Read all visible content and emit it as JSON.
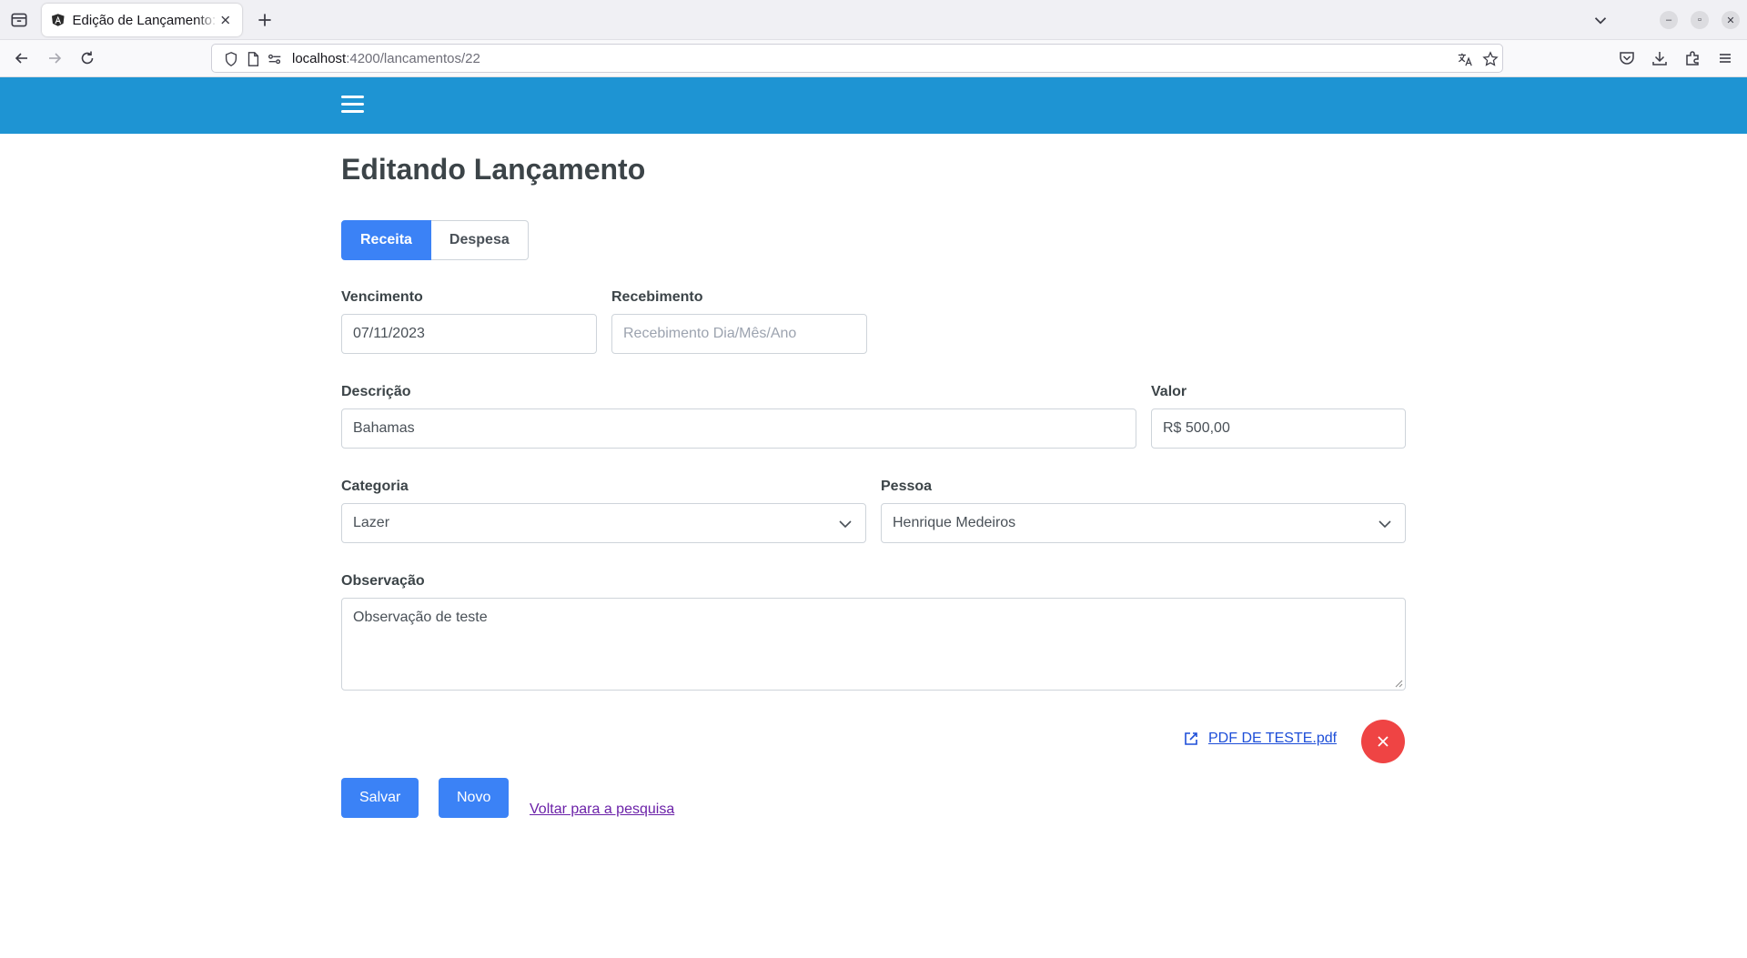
{
  "browser": {
    "tab_title": "Edição de Lançamento: B",
    "url_host": "localhost",
    "url_path": ":4200/lancamentos/22"
  },
  "page": {
    "title": "Editando Lançamento"
  },
  "type_toggle": {
    "options": [
      "Receita",
      "Despesa"
    ],
    "selected": "Receita"
  },
  "form": {
    "vencimento": {
      "label": "Vencimento",
      "value": "07/11/2023"
    },
    "recebimento": {
      "label": "Recebimento",
      "value": "",
      "placeholder": "Recebimento Dia/Mês/Ano"
    },
    "descricao": {
      "label": "Descrição",
      "value": "Bahamas"
    },
    "valor": {
      "label": "Valor",
      "value": "R$ 500,00"
    },
    "categoria": {
      "label": "Categoria",
      "value": "Lazer"
    },
    "pessoa": {
      "label": "Pessoa",
      "value": "Henrique Medeiros"
    },
    "observacao": {
      "label": "Observação",
      "value": "Observação de teste"
    }
  },
  "attachment": {
    "name": "PDF DE TESTE.pdf"
  },
  "actions": {
    "save_label": "Salvar",
    "new_label": "Novo",
    "back_label": "Voltar para a pesquisa"
  },
  "colors": {
    "header": "#1e94d3",
    "primary": "#3b82f6",
    "danger": "#ef4444"
  }
}
